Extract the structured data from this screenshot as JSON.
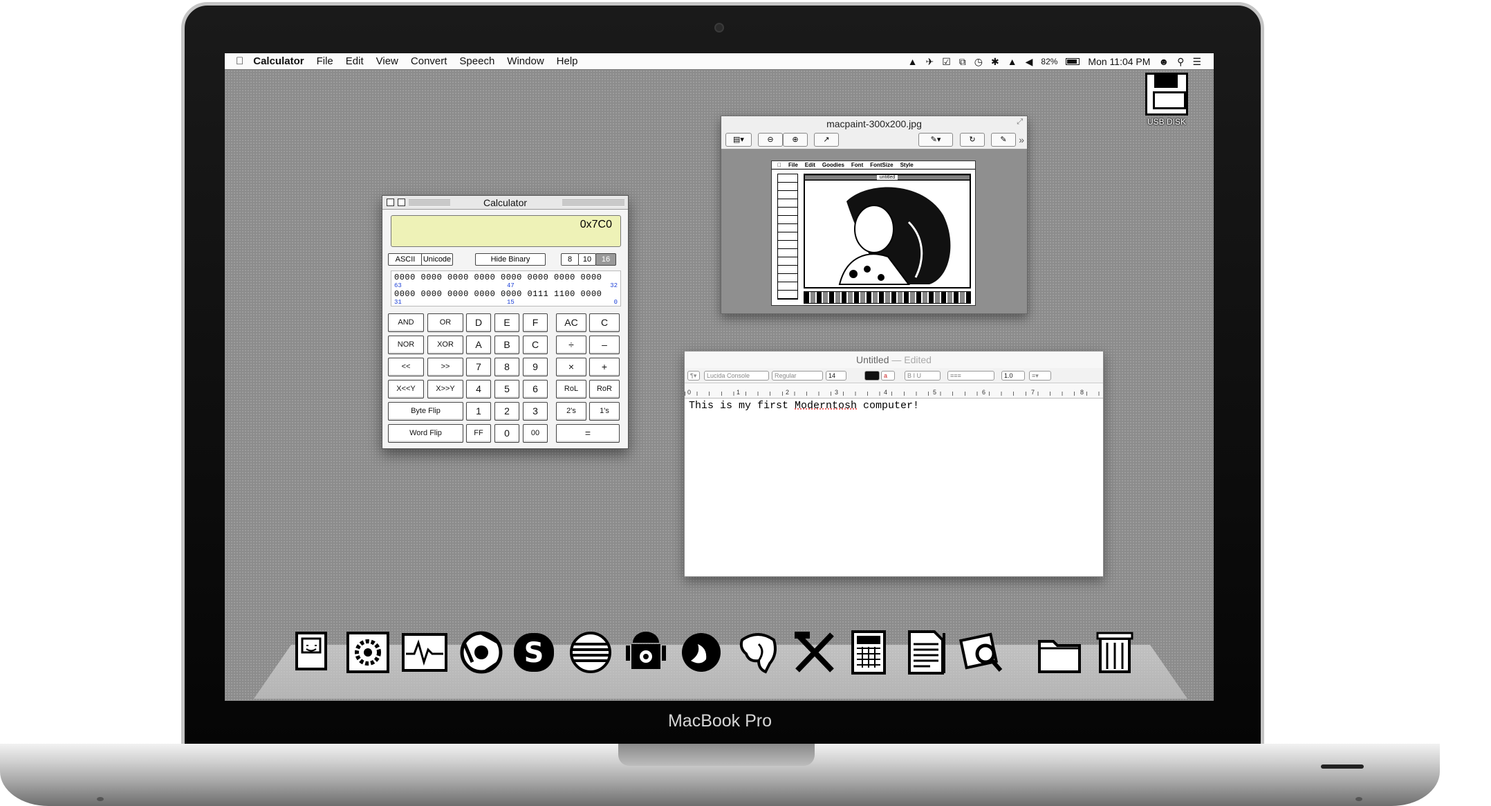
{
  "laptop": {
    "brand": "MacBook Pro"
  },
  "menubar": {
    "app_name": "Calculator",
    "items": [
      "File",
      "Edit",
      "View",
      "Convert",
      "Speech",
      "Window",
      "Help"
    ],
    "battery": "82%",
    "clock": "Mon 11:04 PM"
  },
  "desktop": {
    "usb_label": "USB DISK"
  },
  "calculator": {
    "title": "Calculator",
    "display": "0x7C0",
    "ascii_label": "ASCII",
    "unicode_label": "Unicode",
    "hide_binary": "Hide Binary",
    "base_8": "8",
    "base_10": "10",
    "base_16": "16",
    "binary_row1": "0000 0000 0000 0000 0000 0000 0000 0000",
    "binary_row2": "0000 0000 0000 0000 0000 0111 1100 0000",
    "idx_63": "63",
    "idx_47": "47",
    "idx_32": "32",
    "idx_31": "31",
    "idx_15": "15",
    "idx_0": "0",
    "keys": {
      "and": "AND",
      "or": "OR",
      "d": "D",
      "e": "E",
      "f": "F",
      "ac": "AC",
      "c_clear": "C",
      "nor": "NOR",
      "xor": "XOR",
      "a": "A",
      "b": "B",
      "c": "C",
      "div": "÷",
      "minus": "–",
      "shl": "<<",
      "shr": ">>",
      "k7": "7",
      "k8": "8",
      "k9": "9",
      "mul": "×",
      "plus": "+",
      "xshl": "X<<Y",
      "xshr": "X>>Y",
      "k4": "4",
      "k5": "5",
      "k6": "6",
      "rol": "RoL",
      "ror": "RoR",
      "byteflip": "Byte Flip",
      "k1": "1",
      "k2": "2",
      "k3": "3",
      "twos": "2's",
      "ones": "1's",
      "wordflip": "Word Flip",
      "ff": "FF",
      "k0": "0",
      "k00": "00",
      "eq": "="
    }
  },
  "preview": {
    "title": "macpaint-300x200.jpg",
    "macpaint_menu": [
      "File",
      "Edit",
      "Goodies",
      "Font",
      "FontSize",
      "Style"
    ],
    "macpaint_doc": "untitled"
  },
  "textedit": {
    "title": "Untitled",
    "edited": "— Edited",
    "font": "Lucida Console",
    "style": "Regular",
    "size": "14",
    "spacing": "1.0",
    "content_before": "This is my first ",
    "content_misspelled": "Moderntosh",
    "content_after": " computer!",
    "ruler_numbers": [
      "0",
      "1",
      "2",
      "3",
      "4",
      "5",
      "6",
      "7",
      "8"
    ]
  },
  "dock": {
    "apps": [
      "finder-icon",
      "system-preferences-icon",
      "activity-monitor-icon",
      "chrome-icon",
      "skype-icon",
      "browser-icon",
      "android-icon",
      "firefox-icon",
      "postgres-icon",
      "xcode-icon",
      "calculator-icon",
      "textedit-icon",
      "preview-icon",
      "folder-icon",
      "trash-icon"
    ]
  }
}
